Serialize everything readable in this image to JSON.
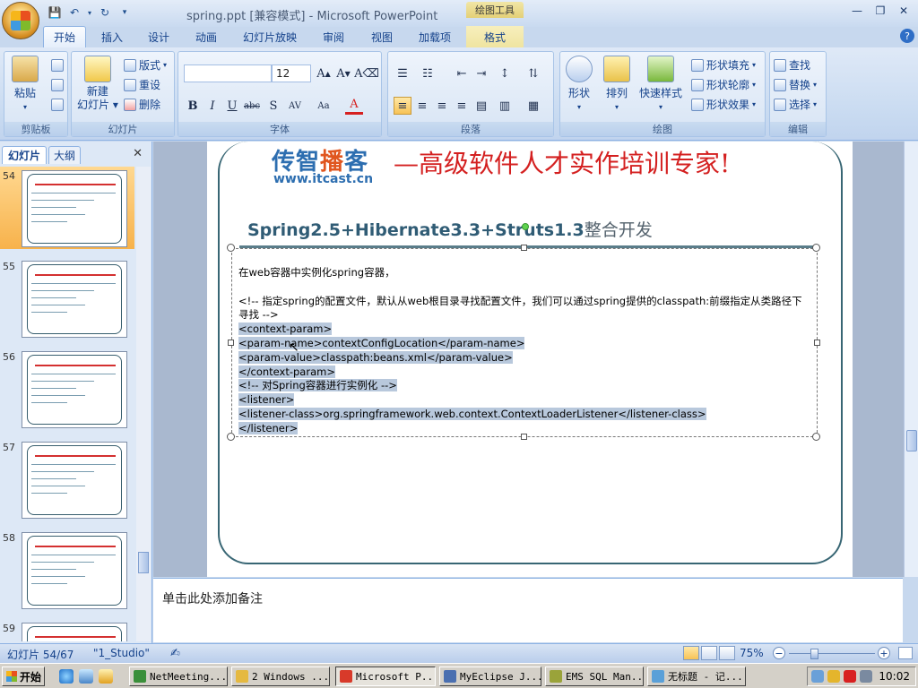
{
  "window": {
    "title": "spring.ppt [兼容模式] - Microsoft PowerPoint",
    "context_tab_header": "绘图工具"
  },
  "ribbon": {
    "tabs": [
      "开始",
      "插入",
      "设计",
      "动画",
      "幻灯片放映",
      "审阅",
      "视图",
      "加载项",
      "格式"
    ],
    "active_tab": "开始",
    "groups": {
      "clipboard": {
        "label": "剪贴板",
        "paste": "粘贴"
      },
      "slides": {
        "label": "幻灯片",
        "new_slide": "新建\n幻灯片",
        "layout": "版式",
        "reset": "重设",
        "delete": "删除"
      },
      "font": {
        "label": "字体",
        "font_name": "",
        "font_size": "12"
      },
      "paragraph": {
        "label": "段落"
      },
      "drawing": {
        "label": "绘图",
        "shapes": "形状",
        "arrange": "排列",
        "quick_styles": "快速样式",
        "fill": "形状填充",
        "outline": "形状轮廓",
        "effects": "形状效果"
      },
      "editing": {
        "label": "编辑",
        "find": "查找",
        "replace": "替换",
        "select": "选择"
      }
    }
  },
  "slide_pane": {
    "tabs": [
      "幻灯片",
      "大纲"
    ],
    "thumbnails": [
      {
        "num": "54",
        "selected": true
      },
      {
        "num": "55",
        "selected": false
      },
      {
        "num": "56",
        "selected": false
      },
      {
        "num": "57",
        "selected": false
      },
      {
        "num": "58",
        "selected": false
      },
      {
        "num": "59",
        "selected": false
      }
    ]
  },
  "slide": {
    "brand": "传智播客",
    "brand_url": "www.itcast.cn",
    "tagline": "—高级软件人才实作培训专家!",
    "title": "Spring2.5+Hibernate3.3+Struts1.3",
    "title_cn": "整合开发",
    "lines": [
      {
        "text": "在web容器中实例化spring容器，",
        "sel": false
      },
      {
        "text": "",
        "sel": false
      },
      {
        "text": "<!-- 指定spring的配置文件，默认从web根目录寻找配置文件，我们可以通过spring提供的classpath:前缀指定从类路径下",
        "sel": false
      },
      {
        "text": "寻找 -->",
        "sel": false
      },
      {
        "text": "<context-param>",
        "sel": true
      },
      {
        "text": "   <param-name>contextConfigLocation</param-name>",
        "sel": true
      },
      {
        "text": "   <param-value>classpath:beans.xml</param-value>",
        "sel": true
      },
      {
        "text": "</context-param>",
        "sel": true
      },
      {
        "text": "<!-- 对Spring容器进行实例化 -->",
        "sel": true
      },
      {
        "text": "<listener>",
        "sel": true
      },
      {
        "text": "      <listener-class>org.springframework.web.context.ContextLoaderListener</listener-class>",
        "sel": true
      },
      {
        "text": "</listener>",
        "sel": true
      }
    ]
  },
  "notes": {
    "placeholder": "单击此处添加备注"
  },
  "status": {
    "slide_counter": "幻灯片 54/67",
    "theme": "\"1_Studio\"",
    "zoom": "75%",
    "zoom_fraction": 0.29
  },
  "taskbar": {
    "start": "开始",
    "tasks": [
      {
        "label": "NetMeeting...",
        "active": false
      },
      {
        "label": "2 Windows ...",
        "active": false
      },
      {
        "label": "Microsoft P...",
        "active": true
      },
      {
        "label": "MyEclipse J...",
        "active": false
      },
      {
        "label": "EMS SQL Man...",
        "active": false
      },
      {
        "label": "无标题 - 记...",
        "active": false
      }
    ],
    "clock": "10:02"
  }
}
